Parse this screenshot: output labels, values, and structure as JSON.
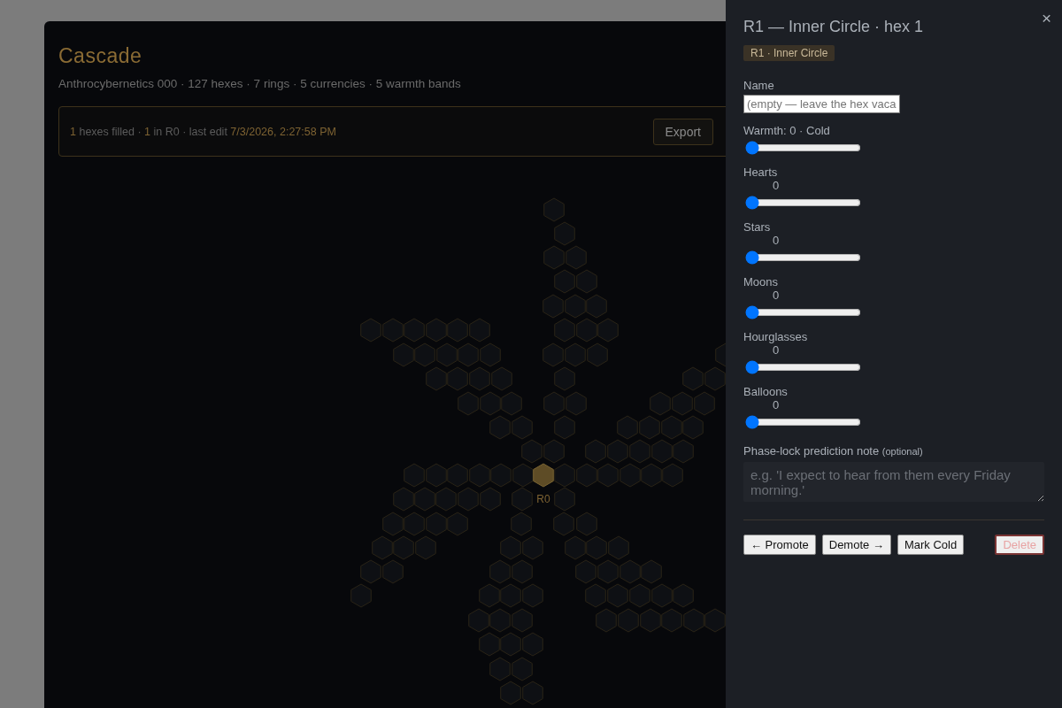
{
  "app": {
    "title": "Cascade",
    "subtitle": "Anthrocybernetics 000 · 127 hexes · 7 rings · 5 currencies · 5 warmth bands",
    "status": [
      {
        "text": "1",
        "highlight": true
      },
      {
        "text": " hexes filled · ",
        "highlight": false
      },
      {
        "text": "1",
        "highlight": true
      },
      {
        "text": " in R0 · last edit ",
        "highlight": false
      },
      {
        "text": "7/3/2026, 2:27:58 PM",
        "highlight": true
      }
    ],
    "buttons": [
      "Export"
    ]
  },
  "map": {
    "center_label": "R0"
  },
  "panel": {
    "title": "R1 — Inner Circle · hex 1",
    "close": "×",
    "badge": "R1 · Inner Circle",
    "name_field": {
      "label": "Name",
      "placeholder": "(empty — leave the hex vaca"
    },
    "sliders": [
      {
        "label": "Warmth: 0 · Cold",
        "level": 0
      },
      {
        "label": "Hearts",
        "reading": "0",
        "level": 0
      },
      {
        "label": "Stars",
        "reading": "0",
        "level": 0
      },
      {
        "label": "Moons",
        "reading": "0",
        "level": 0
      },
      {
        "label": "Hourglasses",
        "reading": "0",
        "level": 0
      },
      {
        "label": "Balloons",
        "reading": "0",
        "level": 0
      }
    ],
    "note": {
      "label": "Phase-lock prediction note",
      "hint": "(optional)",
      "placeholder": "e.g. 'I expect to hear from them every Friday morning.'"
    },
    "actions": [
      {
        "label": "← Promote",
        "kind": "normal"
      },
      {
        "label": "Demote →",
        "kind": "normal"
      },
      {
        "label": "Mark Cold",
        "kind": "normal"
      },
      {
        "label": "Delete",
        "kind": "danger"
      }
    ]
  }
}
